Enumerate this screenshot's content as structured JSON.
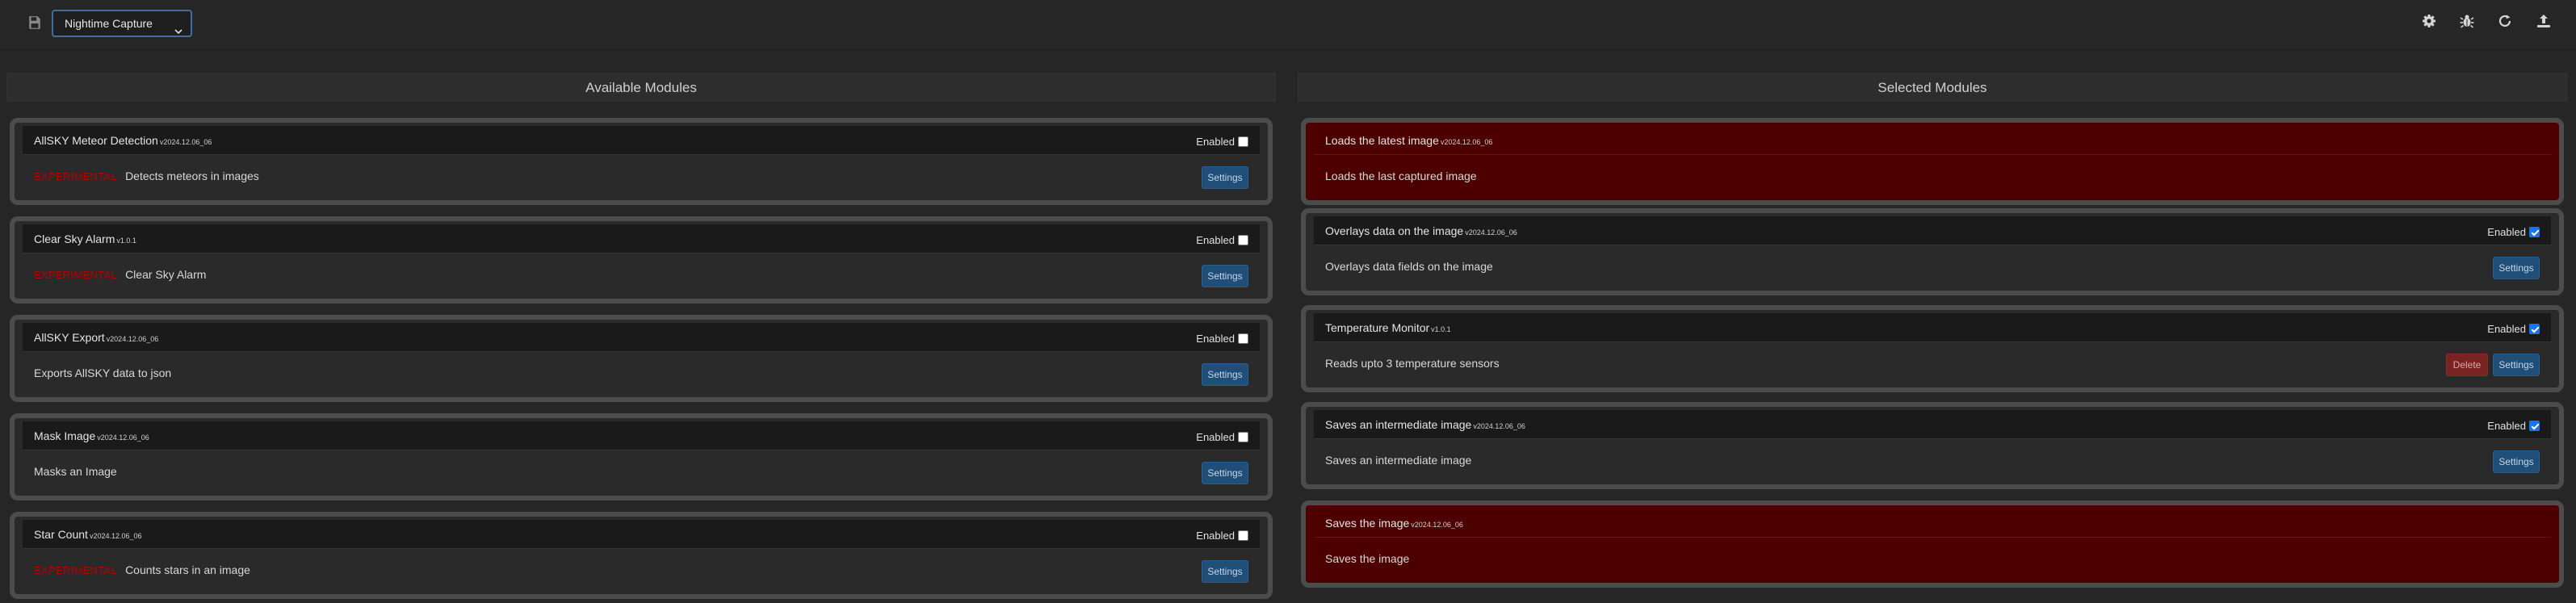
{
  "toolbar": {
    "event_select": {
      "selected": "Nightime Capture"
    },
    "icons": [
      "save-icon",
      "gear-icon",
      "bug-icon",
      "refresh-icon",
      "upload-icon"
    ]
  },
  "colors": {
    "background": "#262626",
    "card_border": "#4c4c4c",
    "error_card": "#4d0000",
    "settings_button": "#1f4e79",
    "delete_button": "#7a2323",
    "experimental_text": "#b30000"
  },
  "available": {
    "title": "Available Modules",
    "modules": [
      {
        "name": "AllSKY Meteor Detection",
        "version": "v2024.12.06_06",
        "enabled_label": "Enabled",
        "enabled": false,
        "experimental": "EXPERIMENTAL",
        "description": "Detects meteors in images",
        "settings_label": "Settings"
      },
      {
        "name": "Clear Sky Alarm",
        "version": "v1.0.1",
        "enabled_label": "Enabled",
        "enabled": false,
        "experimental": "EXPERIMENTAL",
        "description": "Clear Sky Alarm",
        "settings_label": "Settings"
      },
      {
        "name": "AllSKY Export",
        "version": "v2024.12.06_06",
        "enabled_label": "Enabled",
        "enabled": false,
        "experimental": "",
        "description": "Exports AllSKY data to json",
        "settings_label": "Settings"
      },
      {
        "name": "Mask Image",
        "version": "v2024.12.06_06",
        "enabled_label": "Enabled",
        "enabled": false,
        "experimental": "",
        "description": "Masks an Image",
        "settings_label": "Settings"
      },
      {
        "name": "Star Count",
        "version": "v2024.12.06_06",
        "enabled_label": "Enabled",
        "enabled": false,
        "experimental": "EXPERIMENTAL",
        "description": "Counts stars in an image",
        "settings_label": "Settings"
      }
    ]
  },
  "selected": {
    "title": "Selected Modules",
    "modules": [
      {
        "name": "Loads the latest image",
        "version": "v2024.12.06_06",
        "description": "Loads the last captured image"
      },
      {
        "name": "Overlays data on the image",
        "version": "v2024.12.06_06",
        "enabled_label": "Enabled",
        "enabled": true,
        "description": "Overlays data fields on the image",
        "settings_label": "Settings"
      },
      {
        "name": "Temperature Monitor",
        "version": "v1.0.1",
        "enabled_label": "Enabled",
        "enabled": true,
        "description": "Reads upto 3 temperature sensors",
        "delete_label": "Delete",
        "settings_label": "Settings"
      },
      {
        "name": "Saves an intermediate image",
        "version": "v2024.12.06_06",
        "enabled_label": "Enabled",
        "enabled": true,
        "description": "Saves an intermediate image",
        "settings_label": "Settings"
      },
      {
        "name": "Saves the image",
        "version": "v2024.12.06_06",
        "description": "Saves the image"
      }
    ]
  }
}
